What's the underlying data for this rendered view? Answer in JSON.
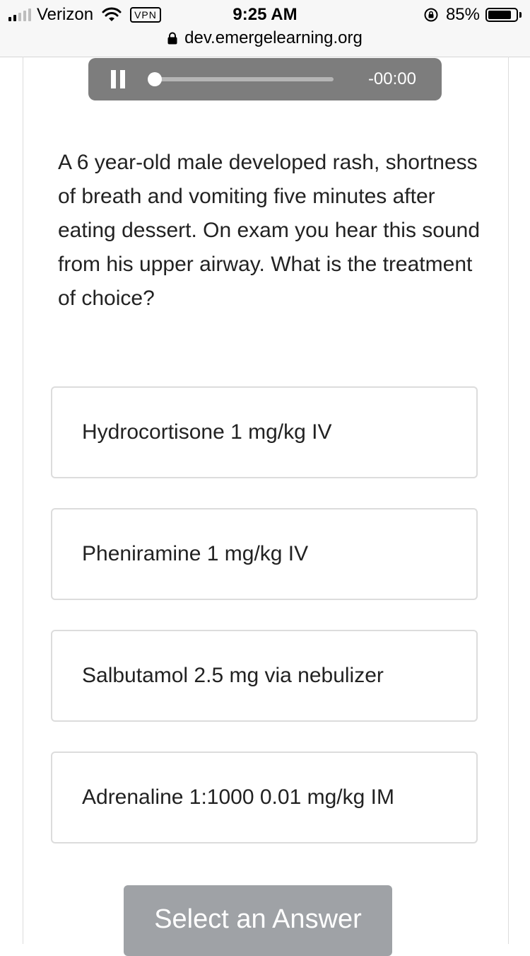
{
  "status_bar": {
    "carrier": "Verizon",
    "vpn": "VPN",
    "time": "9:25 AM",
    "battery": "85%",
    "battery_level": 0.85
  },
  "browser": {
    "url": "dev.emergelearning.org"
  },
  "player": {
    "time_remaining": "-00:00",
    "progress": 0.0
  },
  "question": {
    "text": "A 6 year-old male developed rash, shortness of breath and vomiting five minutes after eating dessert. On exam you hear this sound from his upper airway. What is the treatment of choice?"
  },
  "options": [
    {
      "label": "Hydrocortisone 1 mg/kg IV"
    },
    {
      "label": "Pheniramine 1 mg/kg IV"
    },
    {
      "label": "Salbutamol 2.5 mg via nebulizer"
    },
    {
      "label": "Adrenaline 1:1000 0.01 mg/kg IM"
    }
  ],
  "submit": {
    "label": "Select an Answer"
  }
}
